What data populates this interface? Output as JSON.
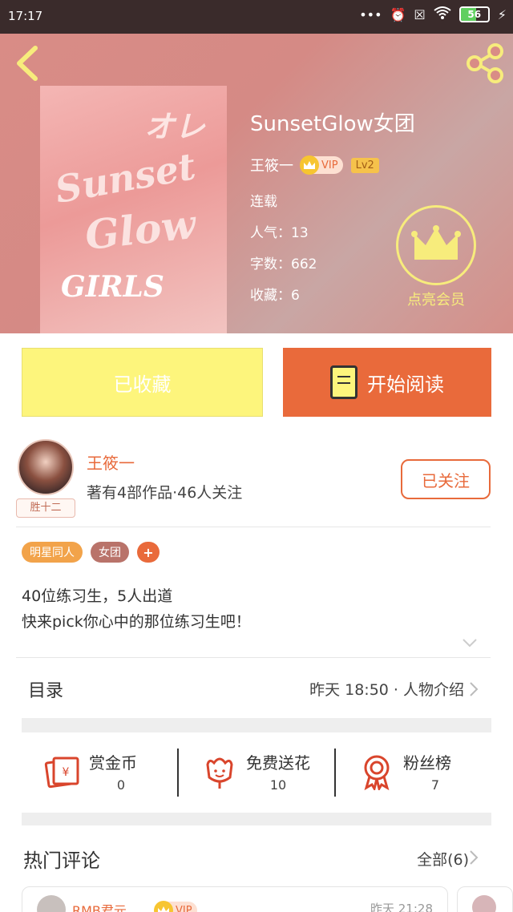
{
  "status_bar": {
    "time": "17:17",
    "icons": [
      "more-dots-icon",
      "alarm-icon",
      "close-box-icon",
      "wifi-icon",
      "battery-icon",
      "charging-icon"
    ],
    "battery": "56",
    "battery_level": 0.56
  },
  "book": {
    "title": "SunsetGlow女团",
    "author": "王筱一",
    "vip_label": "VIP",
    "level": "Lv2",
    "status": "连载",
    "popularity": "人气：13",
    "word_count": "字数：662",
    "favorites": "收藏：6",
    "cover_lines": [
      "Sunset",
      "Glow",
      "GIRLS",
      "オレ"
    ]
  },
  "member": {
    "label": "点亮会员"
  },
  "actions": {
    "favorited": "已收藏",
    "start_reading": "开始阅读"
  },
  "author_card": {
    "name": "王筱一",
    "summary": "著有4部作品·46人关注",
    "avatar_tag": "胜十二",
    "follow": "已关注"
  },
  "tags": [
    "明星同人",
    "女团",
    "+"
  ],
  "description": [
    "40位练习生，5人出道",
    "快来pick你心中的那位练习生吧！"
  ],
  "toc": {
    "title": "目录",
    "info": "昨天 18:50 · 人物介绍"
  },
  "stats": [
    {
      "label": "赏金币",
      "value": "0",
      "icon": "red-envelope-icon"
    },
    {
      "label": "免费送花",
      "value": "10",
      "icon": "flower-icon"
    },
    {
      "label": "粉丝榜",
      "value": "7",
      "icon": "medal-icon"
    }
  ],
  "comments": {
    "title": "热门评论",
    "all": "全部(6)",
    "first": {
      "name": "RMB君元",
      "vip": "VIP",
      "time": "昨天 21:28"
    }
  },
  "colors": {
    "accent": "#e96a3b",
    "yellow": "#fdf57c",
    "header": "#d98c86"
  }
}
